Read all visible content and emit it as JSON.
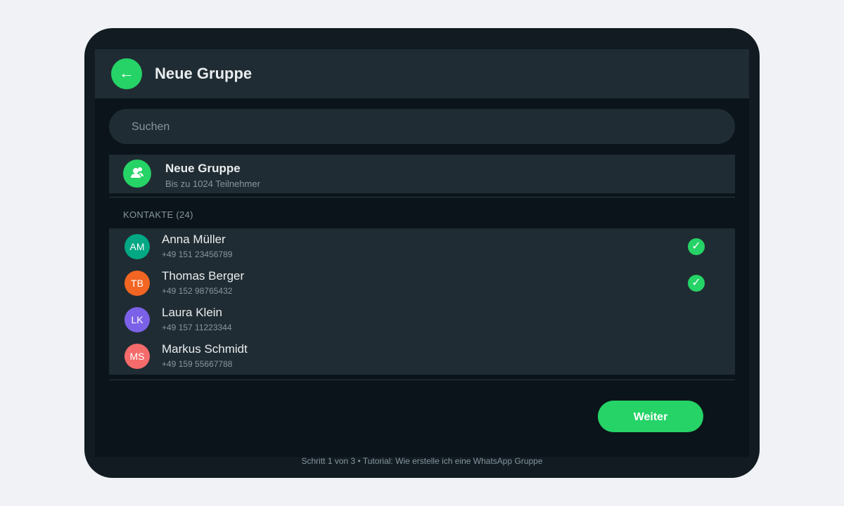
{
  "colors": {
    "accent": "#25d366",
    "background": "#0b141a",
    "panel": "#202c33",
    "frame": "#111b21",
    "primary_text": "#e9edef",
    "secondary_text": "#8696a0"
  },
  "header": {
    "back_icon": "←",
    "title": "Neue Gruppe"
  },
  "search": {
    "placeholder": "Suchen",
    "value": ""
  },
  "new_group": {
    "icon": "group-add-icon",
    "title": "Neue Gruppe",
    "subtitle": "Bis zu 1024 Teilnehmer"
  },
  "contacts": {
    "section_label": "KONTAKTE (24)",
    "items": [
      {
        "initials": "AM",
        "name": "Anna Müller",
        "phone": "+49 151 23456789",
        "avatar_color": "#00a884",
        "selected": true
      },
      {
        "initials": "TB",
        "name": "Thomas Berger",
        "phone": "+49 152 98765432",
        "avatar_color": "#f26522",
        "selected": true
      },
      {
        "initials": "LK",
        "name": "Laura Klein",
        "phone": "+49 157 11223344",
        "avatar_color": "#7b61e8",
        "selected": false
      },
      {
        "initials": "MS",
        "name": "Markus Schmidt",
        "phone": "+49 159 55667788",
        "avatar_color": "#f56b6b",
        "selected": false
      }
    ],
    "check_glyph": "✓"
  },
  "actions": {
    "next_label": "Weiter"
  },
  "footer": {
    "text": "Schritt 1 von 3 • Tutorial: Wie erstelle ich eine WhatsApp Gruppe"
  }
}
